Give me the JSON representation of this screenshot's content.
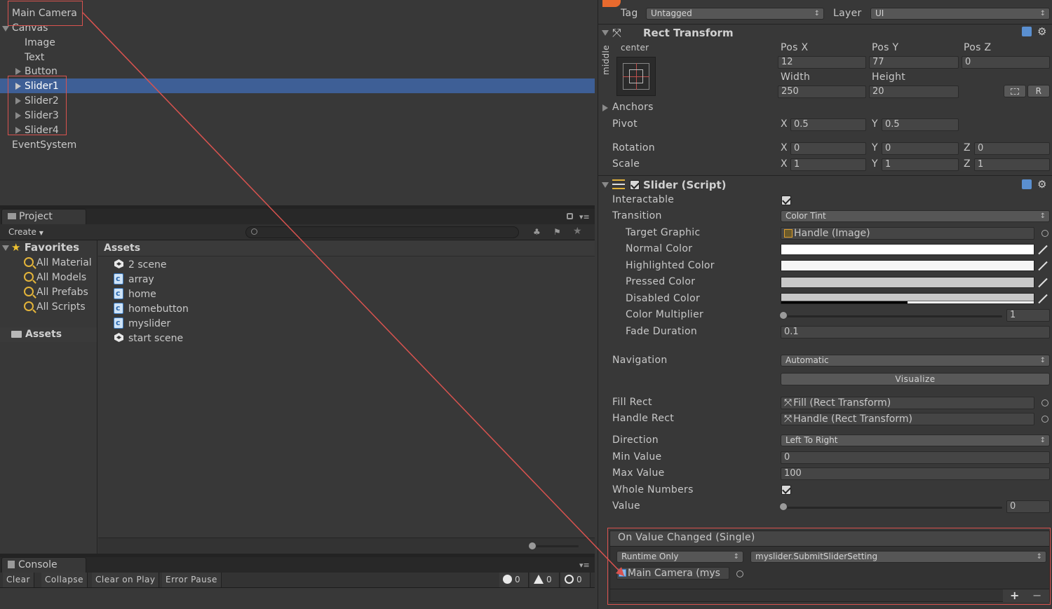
{
  "hierarchy": {
    "items": [
      {
        "label": "Main Camera"
      },
      {
        "label": "Canvas"
      },
      {
        "label": "Image"
      },
      {
        "label": "Text"
      },
      {
        "label": "Button"
      },
      {
        "label": "Slider1"
      },
      {
        "label": "Slider2"
      },
      {
        "label": "Slider3"
      },
      {
        "label": "Slider4"
      },
      {
        "label": "EventSystem"
      }
    ]
  },
  "project": {
    "tab_label": "Project",
    "create_label": "Create",
    "favorites_label": "Favorites",
    "favorites": [
      "All Material",
      "All Models",
      "All Prefabs",
      "All Scripts"
    ],
    "assets_root_label": "Assets",
    "assets_header": "Assets",
    "assets": [
      {
        "name": "2 scene",
        "icon": "unity-scene-icon"
      },
      {
        "name": "array",
        "icon": "csharp-script-icon"
      },
      {
        "name": "home",
        "icon": "csharp-script-icon"
      },
      {
        "name": "homebutton",
        "icon": "csharp-script-icon"
      },
      {
        "name": "myslider",
        "icon": "csharp-script-icon"
      },
      {
        "name": "start scene",
        "icon": "unity-scene-icon"
      }
    ]
  },
  "console": {
    "tab_label": "Console",
    "buttons": [
      "Clear",
      "Collapse",
      "Clear on Play",
      "Error Pause"
    ],
    "counts": {
      "info": "0",
      "warning": "0",
      "error": "0"
    }
  },
  "inspector": {
    "tag_label": "Tag",
    "tag_value": "Untagged",
    "layer_label": "Layer",
    "layer_value": "UI",
    "rect_transform": {
      "title": "Rect Transform",
      "anchor_h": "center",
      "anchor_v": "middle",
      "pos_x_label": "Pos X",
      "pos_y_label": "Pos Y",
      "pos_z_label": "Pos Z",
      "pos_x": "12",
      "pos_y": "77",
      "pos_z": "0",
      "width_label": "Width",
      "height_label": "Height",
      "width": "250",
      "height": "20",
      "r_button": "R",
      "anchors_label": "Anchors",
      "pivot_label": "Pivot",
      "pivot_x": "0.5",
      "pivot_y": "0.5",
      "rotation_label": "Rotation",
      "rot_x": "0",
      "rot_y": "0",
      "rot_z": "0",
      "scale_label": "Scale",
      "scale_x": "1",
      "scale_y": "1",
      "scale_z": "1",
      "x": "X",
      "y": "Y",
      "z": "Z"
    },
    "slider": {
      "title": "Slider (Script)",
      "interactable_label": "Interactable",
      "transition_label": "Transition",
      "transition_value": "Color Tint",
      "target_graphic_label": "Target Graphic",
      "target_graphic_value": "Handle (Image)",
      "normal_color_label": "Normal Color",
      "highlighted_color_label": "Highlighted Color",
      "pressed_color_label": "Pressed Color",
      "disabled_color_label": "Disabled Color",
      "color_multiplier_label": "Color Multiplier",
      "color_multiplier_value": "1",
      "fade_duration_label": "Fade Duration",
      "fade_duration_value": "0.1",
      "navigation_label": "Navigation",
      "navigation_value": "Automatic",
      "visualize_label": "Visualize",
      "fill_rect_label": "Fill Rect",
      "fill_rect_value": "Fill (Rect Transform)",
      "handle_rect_label": "Handle Rect",
      "handle_rect_value": "Handle (Rect Transform)",
      "direction_label": "Direction",
      "direction_value": "Left To Right",
      "min_value_label": "Min Value",
      "min_value": "0",
      "max_value_label": "Max Value",
      "max_value": "100",
      "whole_numbers_label": "Whole Numbers",
      "value_label": "Value",
      "value": "0"
    },
    "event": {
      "title": "On Value Changed (Single)",
      "runtime_value": "Runtime Only",
      "function_value": "myslider.SubmitSliderSetting",
      "object_value": "Main Camera (mys",
      "plus": "+",
      "minus": "−"
    }
  },
  "colors": {
    "normal": "#ffffff",
    "highlighted": "#f5f5f5",
    "pressed": "#c8c8c8",
    "disabled": "#c8c8c8",
    "selection": "#3e5f96",
    "annotation": "#d9534f"
  }
}
